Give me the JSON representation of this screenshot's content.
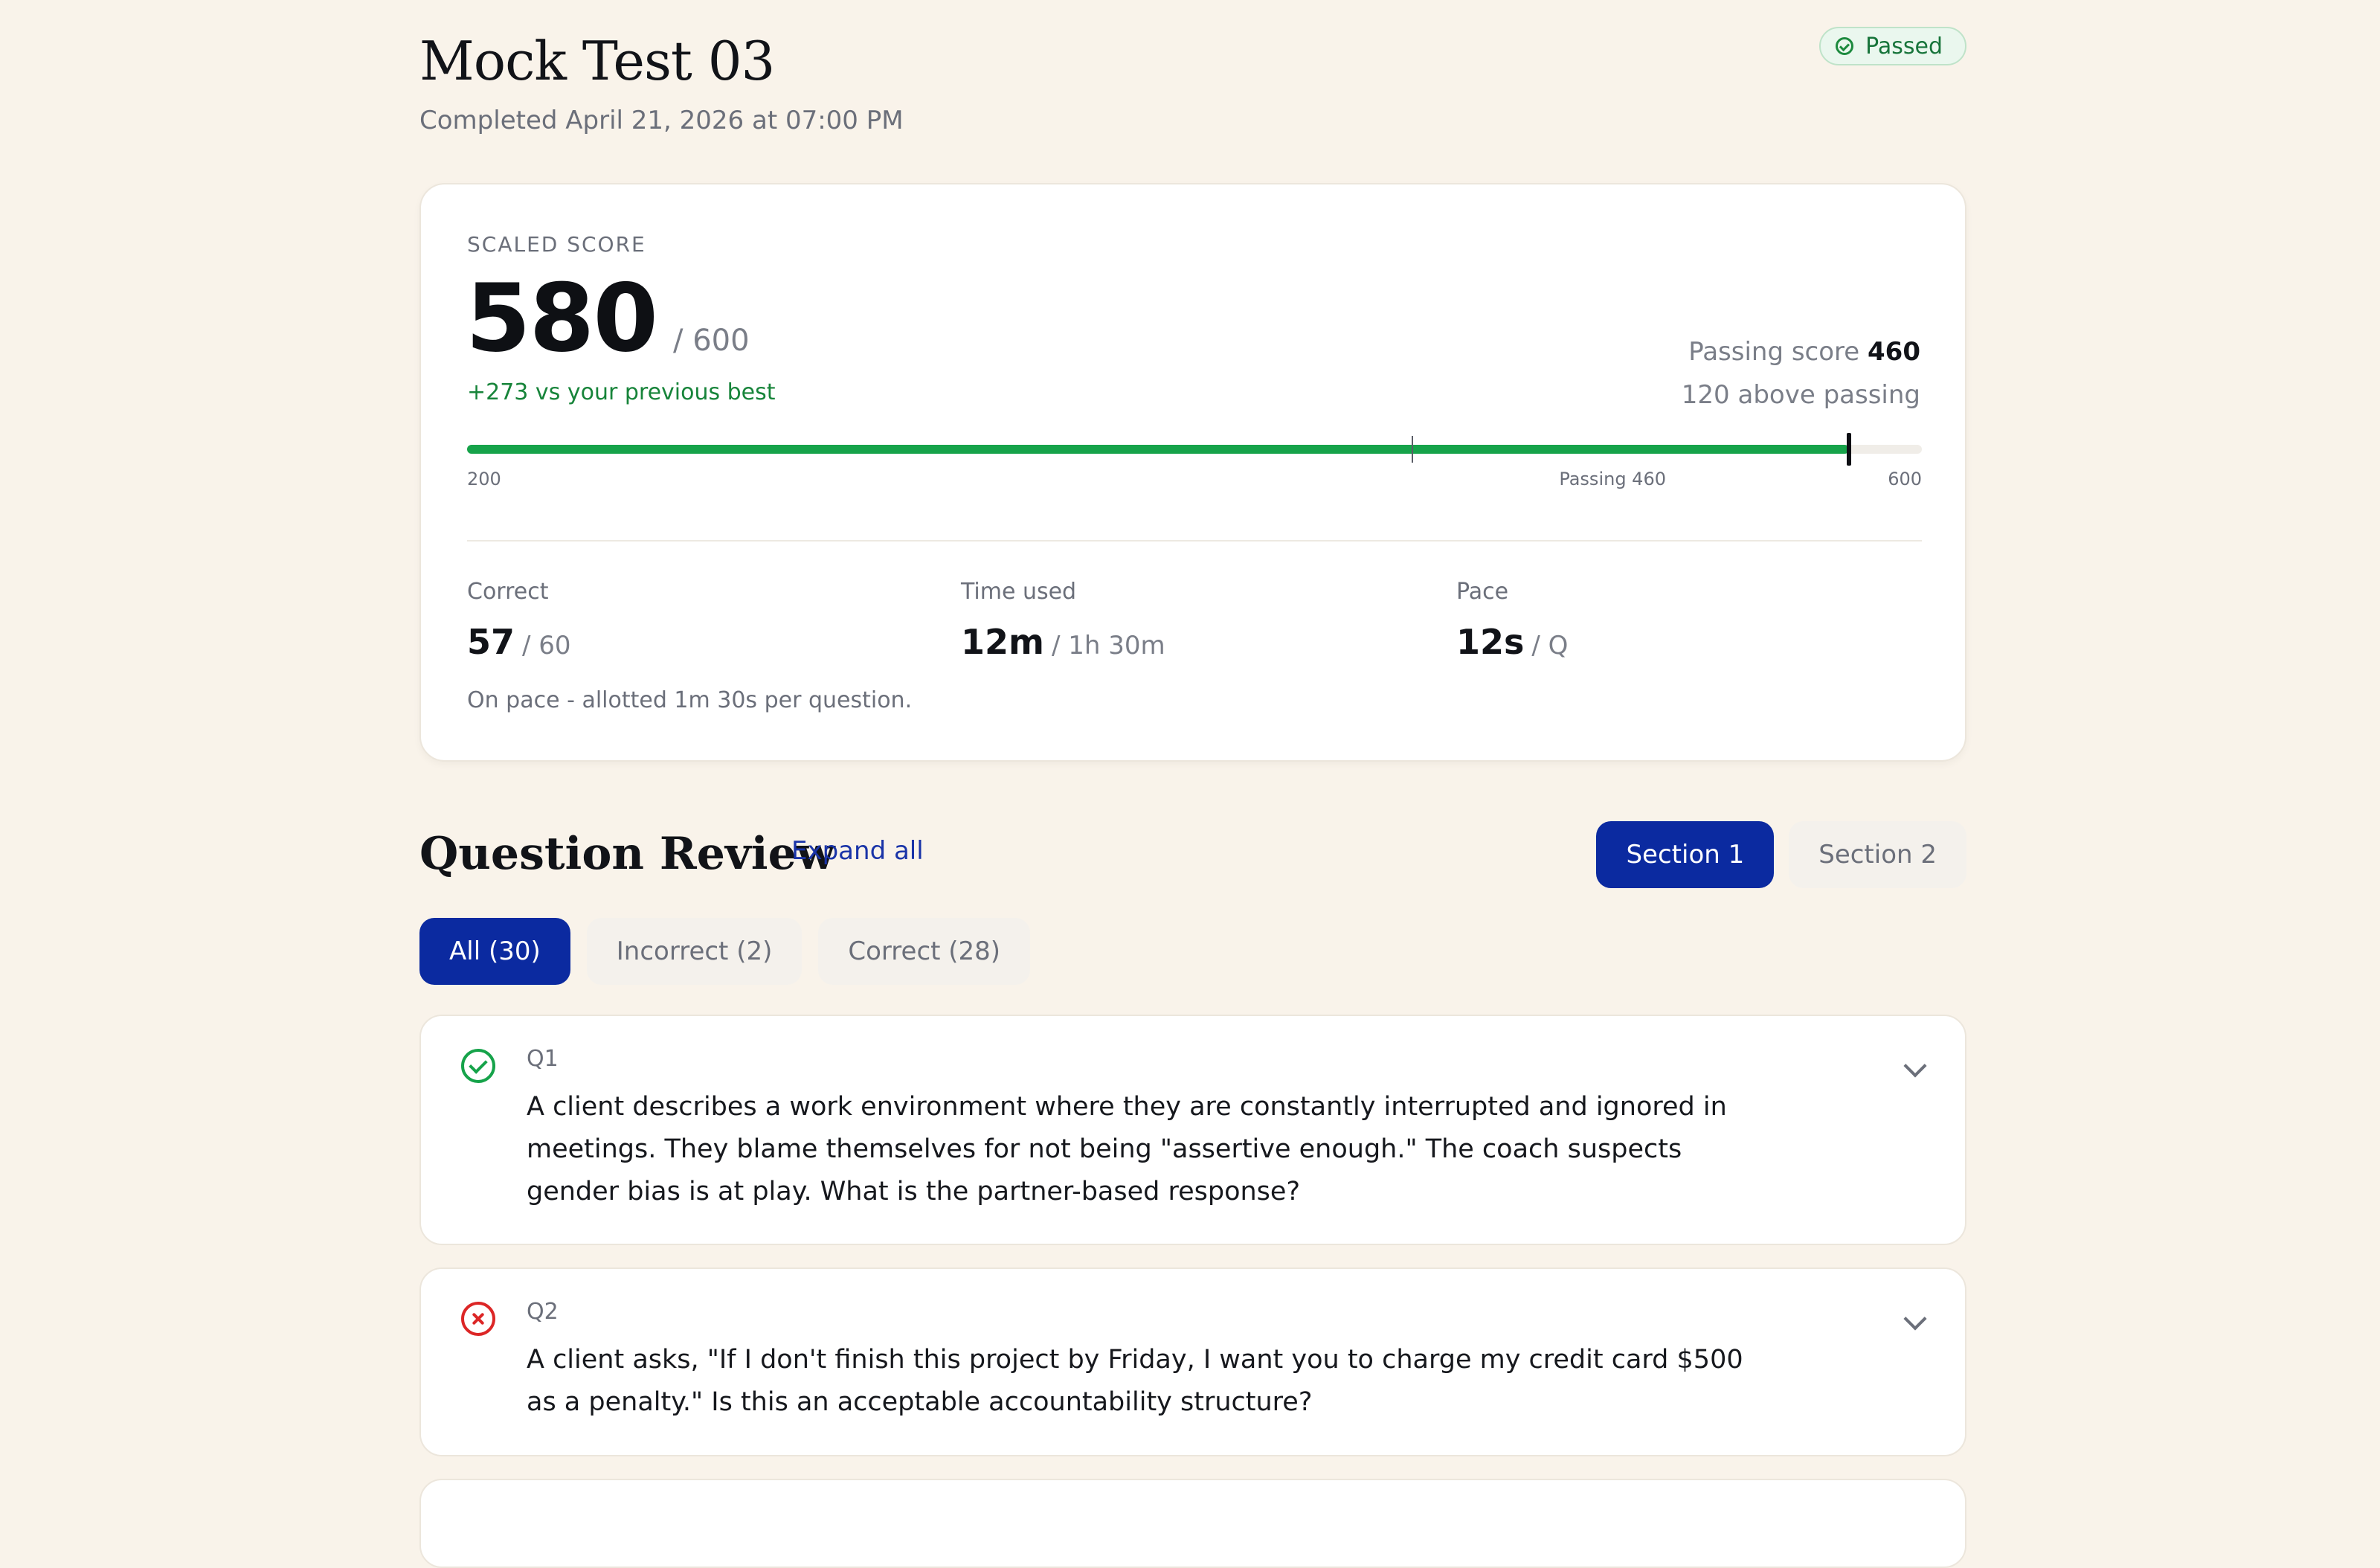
{
  "header": {
    "title": "Mock Test 03",
    "completed": "Completed April 21, 2026 at 07:00 PM",
    "status_badge": "Passed"
  },
  "score": {
    "label": "SCALED SCORE",
    "value": "580",
    "max": "/ 600",
    "improvement": "+273 vs your previous best",
    "passing_label": "Passing score",
    "passing_value": "460",
    "above_passing": "120 above passing",
    "range_min_label": "200",
    "range_max_label": "600",
    "passing_marker_label": "Passing 460",
    "range_min": 200,
    "range_max": 600,
    "passing": 460,
    "score_num": 580
  },
  "stats": {
    "correct": {
      "label": "Correct",
      "value": "57",
      "sub": "/ 60"
    },
    "time": {
      "label": "Time used",
      "value": "12m",
      "sub": "/ 1h 30m"
    },
    "pace": {
      "label": "Pace",
      "value": "12s",
      "sub": "/ Q"
    },
    "note": "On pace - allotted 1m 30s per question."
  },
  "review": {
    "title": "Question Review",
    "expand_all": "Expand all",
    "sections": [
      {
        "label": "Section 1",
        "active": true
      },
      {
        "label": "Section 2",
        "active": false
      }
    ],
    "filters": [
      {
        "label": "All (30)",
        "active": true
      },
      {
        "label": "Incorrect (2)",
        "active": false
      },
      {
        "label": "Correct (28)",
        "active": false
      }
    ]
  },
  "questions": [
    {
      "number": "Q1",
      "status": "correct",
      "text": "A client describes a work environment where they are constantly interrupted and ignored in meetings. They blame themselves for not being \"assertive enough.\" The coach suspects gender bias is at play. What is the partner-based response?"
    },
    {
      "number": "Q2",
      "status": "incorrect",
      "text": "A client asks, \"If I don't finish this project by Friday, I want you to charge my credit card $500 as a penalty.\" Is this an acceptable accountability structure?"
    }
  ],
  "colors": {
    "background": "#f9f3ea",
    "accent": "#0b2aa0",
    "success": "#16a34a",
    "error": "#dc2626"
  }
}
